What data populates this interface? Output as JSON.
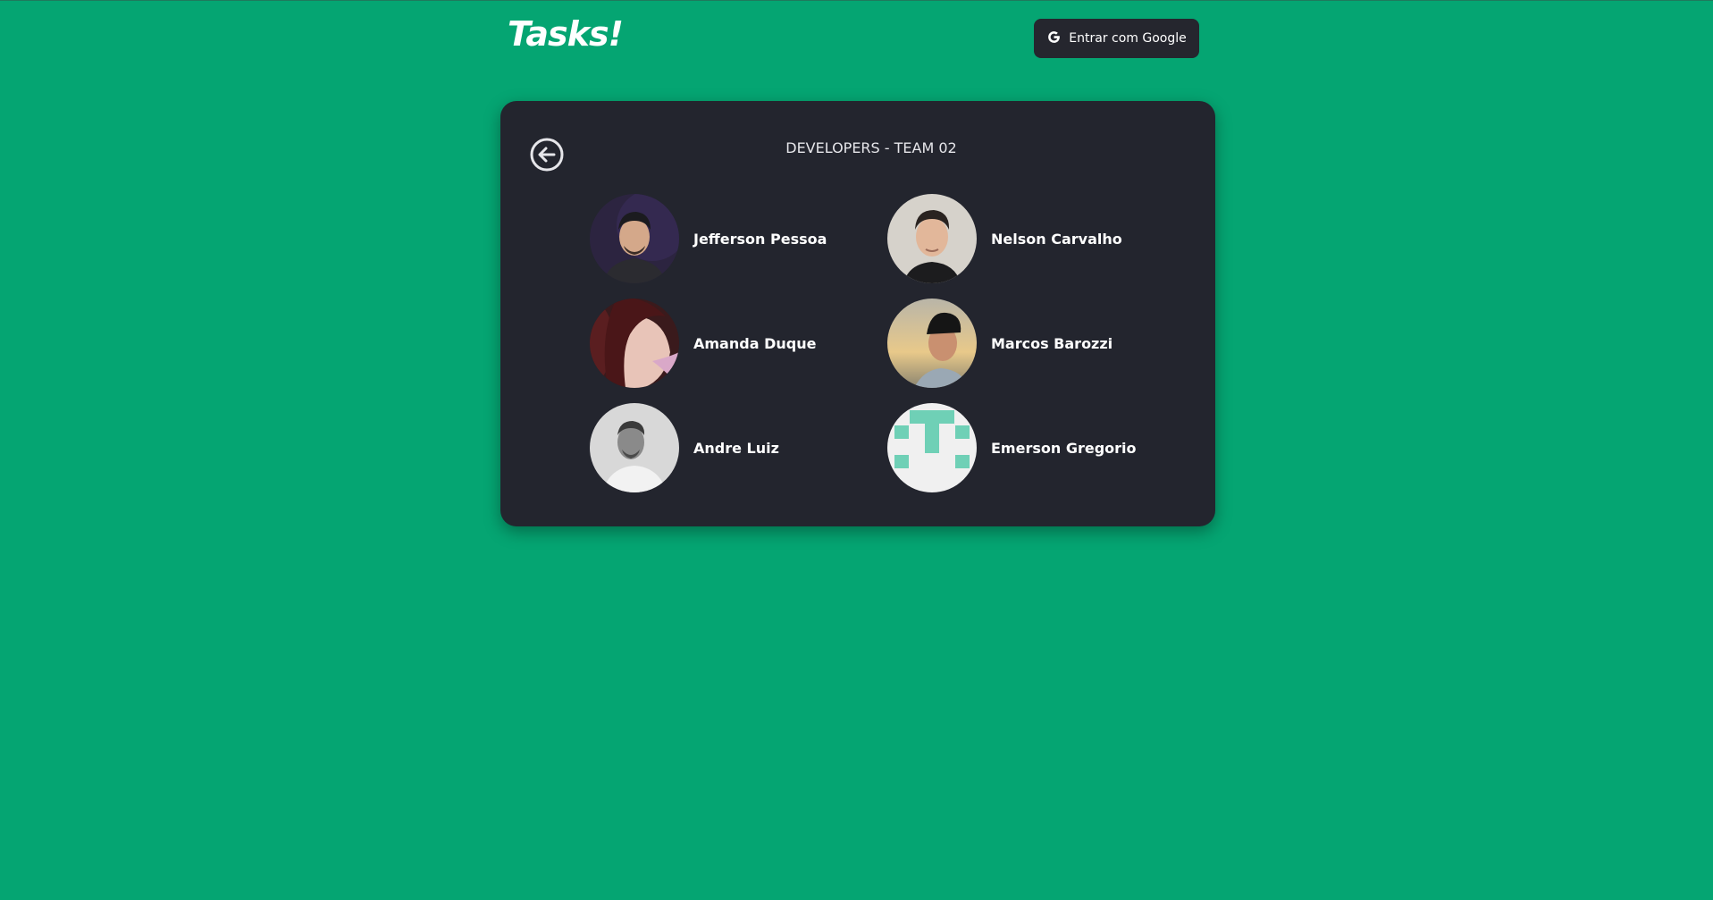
{
  "header": {
    "logo": "Tasks!",
    "login_button": "Entrar com Google"
  },
  "team": {
    "title": "DEVELOPERS - TEAM 02",
    "members": [
      {
        "name": "Jefferson Pessoa"
      },
      {
        "name": "Nelson Carvalho"
      },
      {
        "name": "Amanda Duque"
      },
      {
        "name": "Marcos Barozzi"
      },
      {
        "name": "Andre Luiz"
      },
      {
        "name": "Emerson Gregorio"
      }
    ]
  },
  "colors": {
    "background": "#05a572",
    "card": "#23252e",
    "button": "#25262e"
  },
  "icons": {
    "back": "arrow-left-circle-icon",
    "google": "google-icon"
  }
}
